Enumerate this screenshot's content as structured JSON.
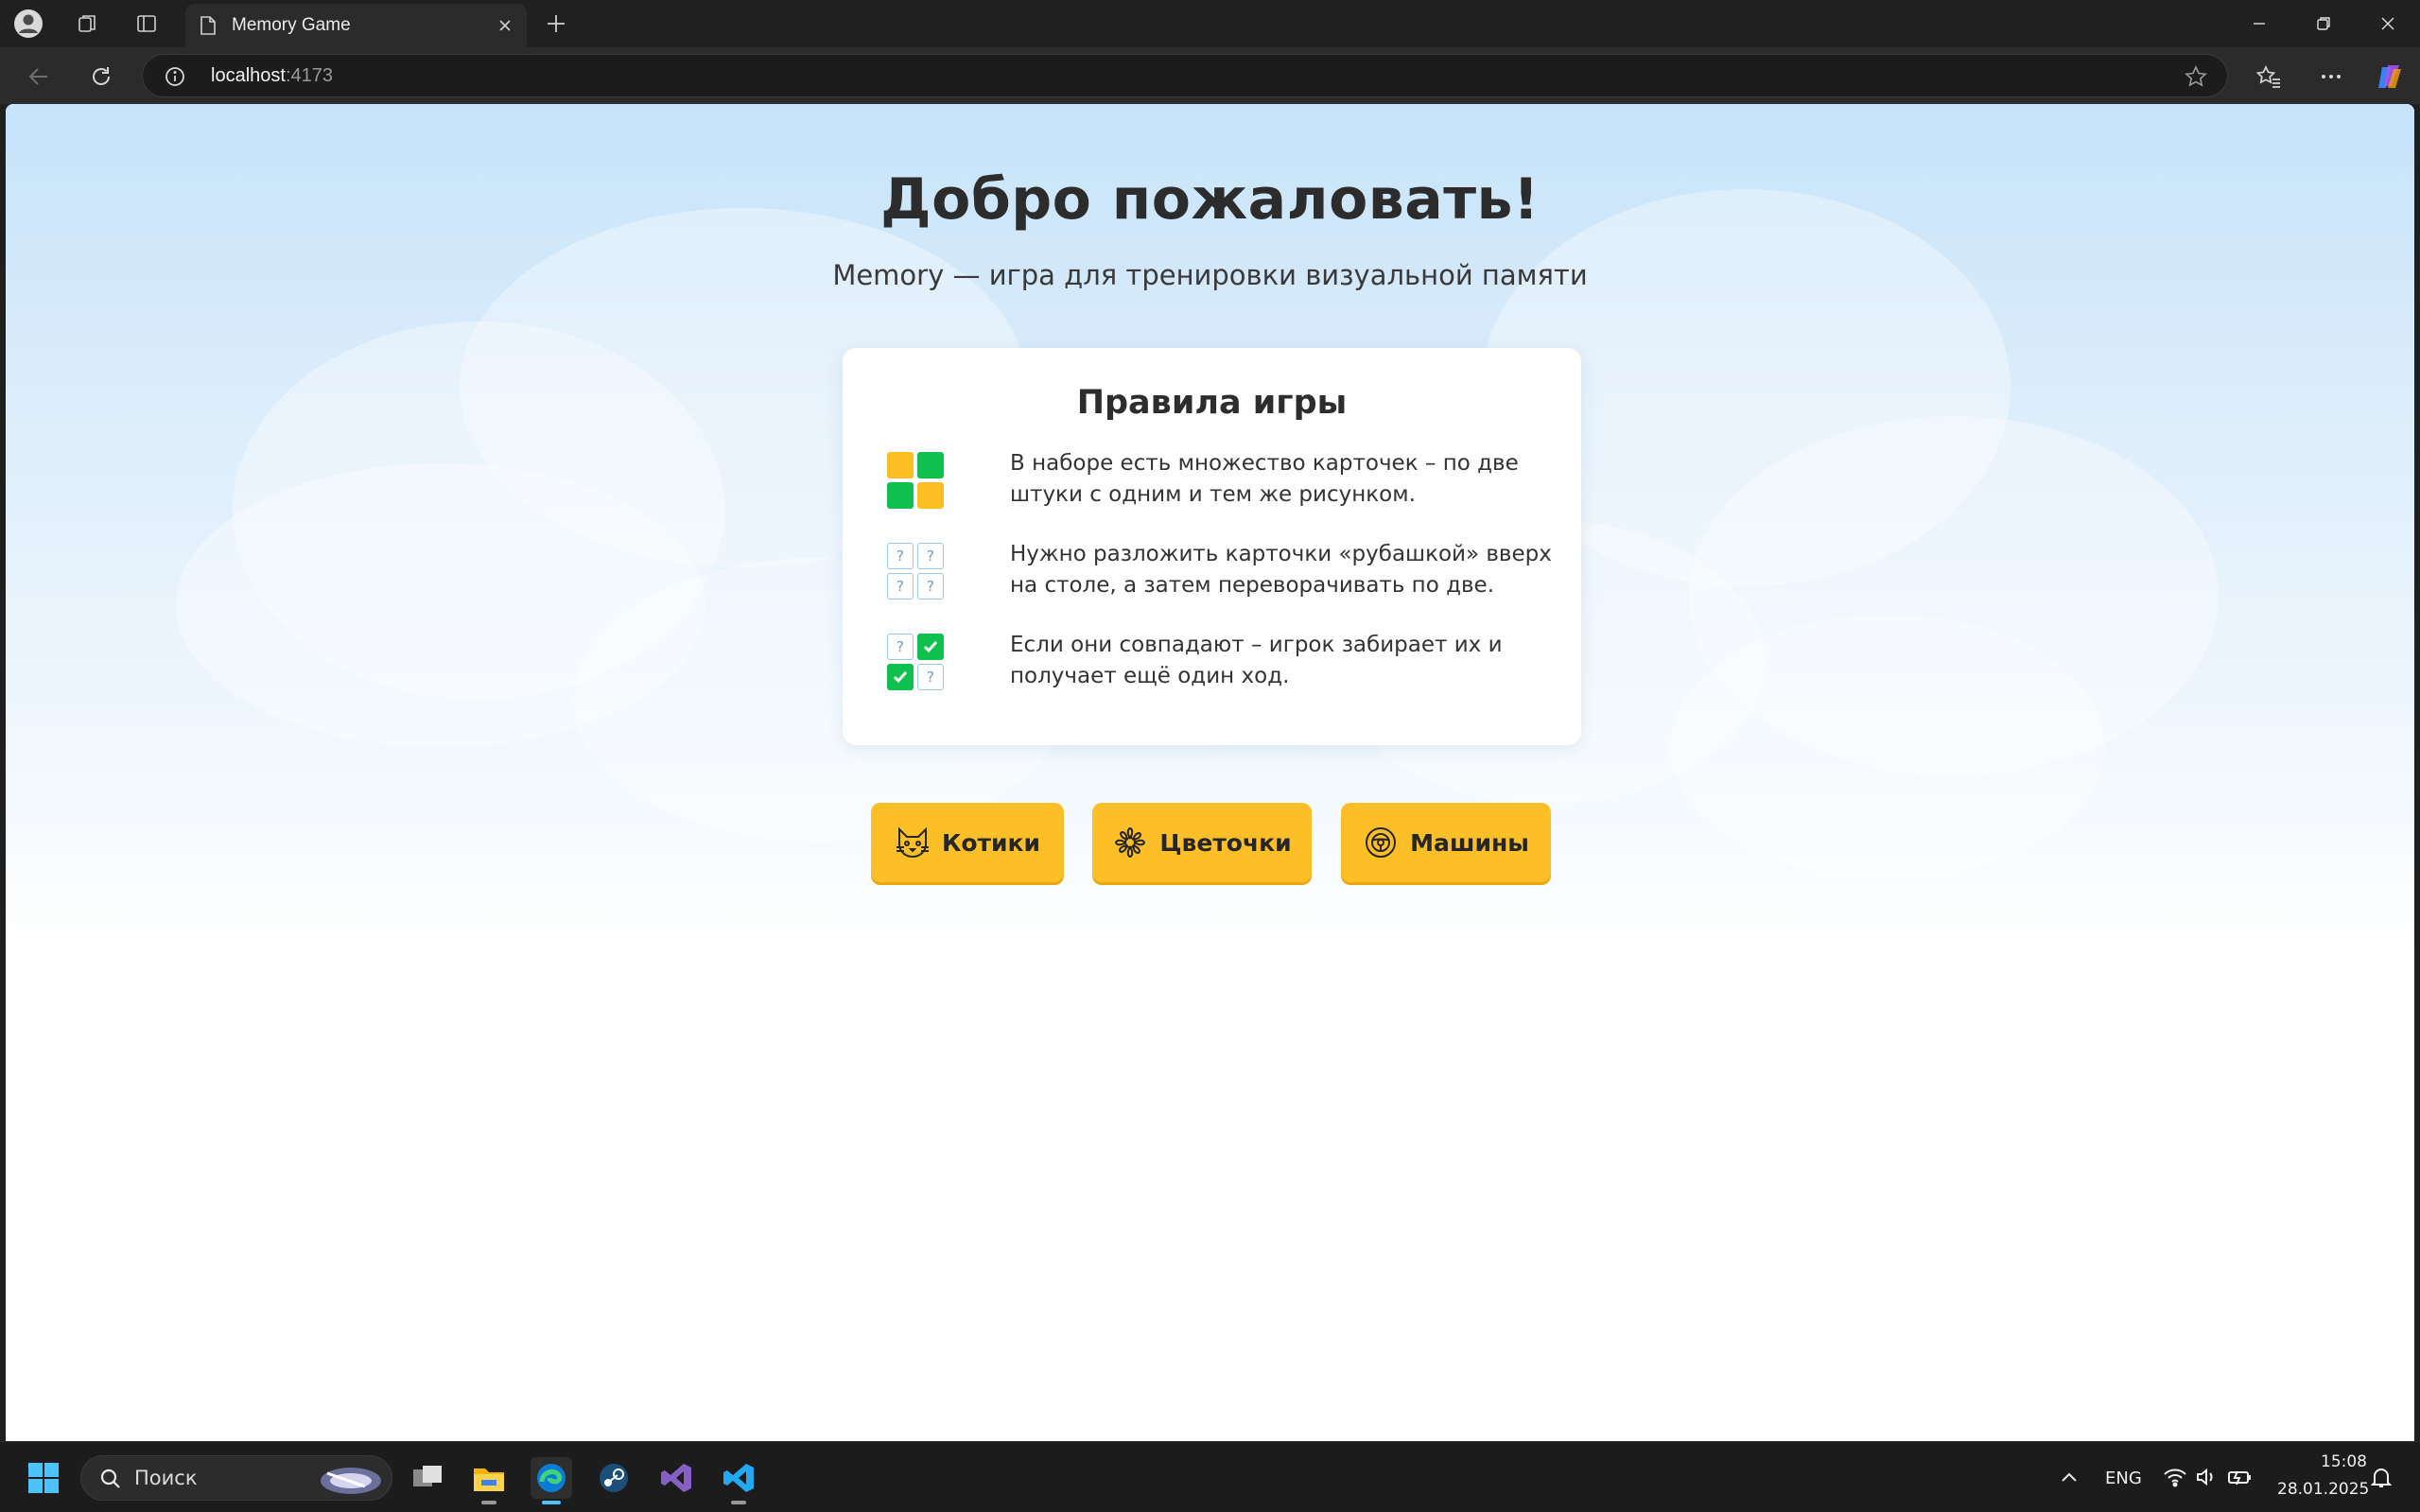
{
  "browser": {
    "tab_title": "Memory Game",
    "url_host": "localhost",
    "url_port": ":4173"
  },
  "page": {
    "heading": "Добро пожаловать!",
    "subtitle": "Memory — игра для тренировки визуальной памяти",
    "rules": {
      "title": "Правила игры",
      "items": [
        {
          "text": "В наборе есть множество карточек – по две штуки с одним и тем же рисунком.",
          "icon": "cards-pairs-icon"
        },
        {
          "text": "Нужно разложить карточки «рубашкой» вверх на столе, а затем переворачивать по две.",
          "icon": "cards-facedown-icon"
        },
        {
          "text": "Если они совпадают – игрок забирает их и получает ещё один ход.",
          "icon": "cards-match-icon"
        }
      ]
    },
    "themes": [
      {
        "label": "Котики",
        "icon": "cat-icon"
      },
      {
        "label": "Цветочки",
        "icon": "flower-icon"
      },
      {
        "label": "Машины",
        "icon": "steering-wheel-icon"
      }
    ]
  },
  "taskbar": {
    "search_placeholder": "Поиск",
    "language": "ENG",
    "time": "15:08",
    "date": "28.01.2025"
  },
  "colors": {
    "accent_yellow": "#fdbf27",
    "card_yellow": "#fbbf24",
    "card_green": "#10c04f"
  }
}
